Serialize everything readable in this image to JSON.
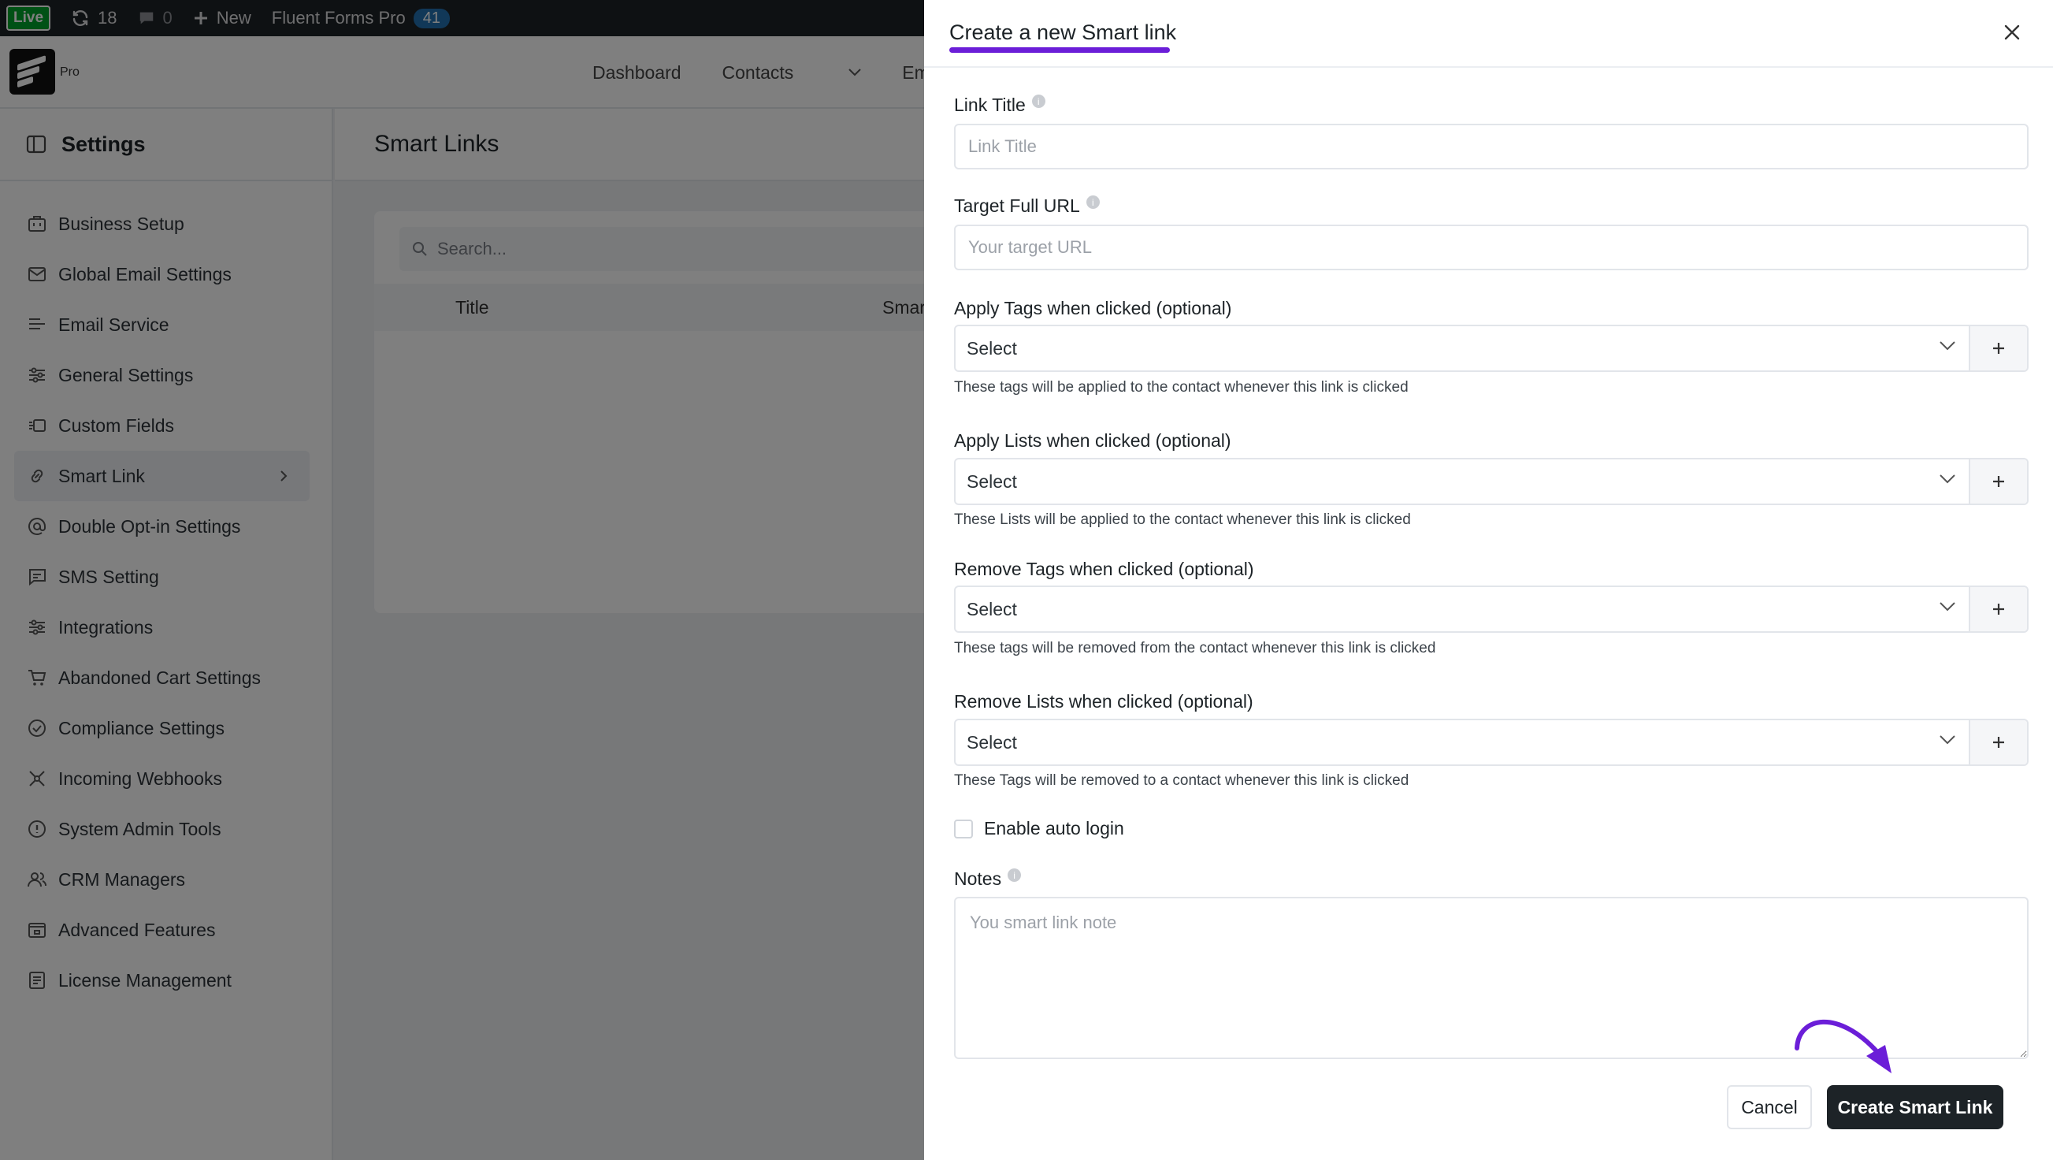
{
  "admin_bar": {
    "live_badge": "Live",
    "updates_count": "18",
    "comments_count": "0",
    "new_label": "New",
    "plugin_label": "Fluent Forms Pro",
    "plugin_count": "41"
  },
  "brand": {
    "pro_label": "Pro"
  },
  "top_nav": {
    "items": [
      "Dashboard",
      "Contacts",
      "Emails"
    ]
  },
  "sidebar": {
    "title": "Settings",
    "items": [
      {
        "label": "Business Setup",
        "icon": "briefcase-icon"
      },
      {
        "label": "Global Email Settings",
        "icon": "email-settings-icon"
      },
      {
        "label": "Email Service",
        "icon": "send-icon"
      },
      {
        "label": "General Settings",
        "icon": "sliders-icon"
      },
      {
        "label": "Custom Fields",
        "icon": "custom-fields-icon"
      },
      {
        "label": "Smart Link",
        "icon": "link-icon",
        "active": true
      },
      {
        "label": "Double Opt-in Settings",
        "icon": "at-sign-icon"
      },
      {
        "label": "SMS Setting",
        "icon": "message-icon"
      },
      {
        "label": "Integrations",
        "icon": "sliders-icon"
      },
      {
        "label": "Abandoned Cart Settings",
        "icon": "cart-icon"
      },
      {
        "label": "Compliance Settings",
        "icon": "check-circle-icon"
      },
      {
        "label": "Incoming Webhooks",
        "icon": "webhook-icon"
      },
      {
        "label": "System Admin Tools",
        "icon": "info-circle-icon"
      },
      {
        "label": "CRM Managers",
        "icon": "users-icon"
      },
      {
        "label": "Advanced Features",
        "icon": "feature-box-icon"
      },
      {
        "label": "License Management",
        "icon": "license-icon"
      }
    ]
  },
  "main": {
    "title": "Smart Links",
    "search_placeholder": "Search...",
    "table_headers": [
      "Title",
      "Smar"
    ]
  },
  "drawer": {
    "title": "Create a new Smart link",
    "fields": {
      "link_title": {
        "label": "Link Title",
        "placeholder": "Link Title",
        "value": ""
      },
      "target_url": {
        "label": "Target Full URL",
        "placeholder": "Your target URL",
        "value": ""
      },
      "apply_tags": {
        "label": "Apply Tags when clicked (optional)",
        "value": "Select",
        "help": "These tags will be applied to the contact whenever this link is clicked"
      },
      "apply_lists": {
        "label": "Apply Lists when clicked (optional)",
        "value": "Select",
        "help": "These Lists will be applied to the contact whenever this link is clicked"
      },
      "remove_tags": {
        "label": "Remove Tags when clicked (optional)",
        "value": "Select",
        "help": "These tags will be removed from the contact whenever this link is clicked"
      },
      "remove_lists": {
        "label": "Remove Lists when clicked (optional)",
        "value": "Select",
        "help": "These Tags will be removed to a contact whenever this link is clicked"
      },
      "auto_login": {
        "label": "Enable auto login",
        "checked": false
      },
      "notes": {
        "label": "Notes",
        "placeholder": "You smart link note",
        "value": ""
      }
    },
    "buttons": {
      "cancel": "Cancel",
      "create": "Create Smart Link"
    }
  },
  "colors": {
    "accent_purple": "#6b1ed8",
    "admin_bar_bg": "#1d2327",
    "primary_button": "#1d2327",
    "live_badge": "#00a32a",
    "count_badge": "#2271b1"
  }
}
